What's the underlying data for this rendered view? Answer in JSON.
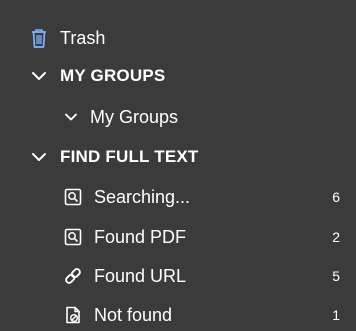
{
  "sidebar": {
    "trash": {
      "label": "Trash",
      "icon": "trash-icon"
    },
    "my_groups_header": {
      "label": "MY GROUPS",
      "icon": "chevron-down-icon"
    },
    "my_groups_item": {
      "label": "My Groups",
      "icon": "chevron-down-icon"
    },
    "find_full_text_header": {
      "label": "FIND FULL TEXT",
      "icon": "chevron-down-icon"
    },
    "items": [
      {
        "label": "Searching...",
        "count": "6",
        "icon": "document-search-icon"
      },
      {
        "label": "Found PDF",
        "count": "2",
        "icon": "document-search-icon"
      },
      {
        "label": "Found URL",
        "count": "5",
        "icon": "link-icon"
      },
      {
        "label": "Not found",
        "count": "1",
        "icon": "document-not-found-icon"
      }
    ]
  },
  "colors": {
    "background": "#3b3b3b",
    "text": "#ffffff",
    "icon_accent": "#7fb3ff"
  }
}
